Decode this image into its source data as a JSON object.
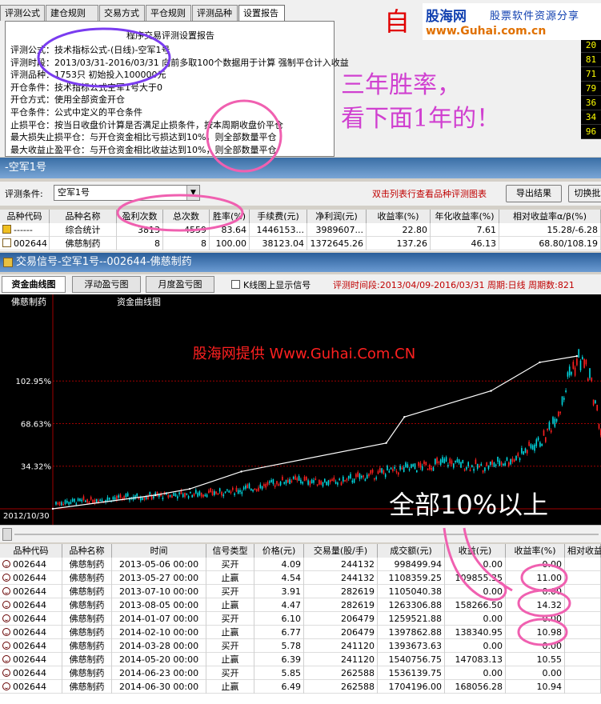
{
  "dialog": {
    "tabs": [
      "评测公式",
      "建仓规则",
      "交易方式",
      "平仓规则",
      "评测品种",
      "设置报告"
    ],
    "active_tab": 5,
    "report_title": "程序交易评测设置报告",
    "report_lines": [
      "评测公式：技术指标公式-(日线)-空军1号",
      "评测时段：2013/03/31-2016/03/31  向前多取100个数据用于计算  强制平仓计入收益",
      "评测品种：1753只  初始投入100000元",
      "开仓条件：技术指标公式空军1号大于0",
      "开仓方式：使用全部资金开仓",
      "平仓条件：公式中定义的平仓条件",
      "止损平仓：按当日收盘价计算是否满足止损条件，按本周期收盘价平仓",
      "          最大损失止损平仓：与开仓资金相比亏损达到10%，则全部数量平仓",
      "          最大收益止盈平仓：与开仓资金相比收益达到10%，则全部数量平仓"
    ],
    "side_numbers": [
      "20",
      "81",
      "71",
      "79",
      "36",
      "34",
      "96"
    ]
  },
  "brand": {
    "name": "股海网",
    "slogan": "股票软件资源分享",
    "url": "www.Guhai.com.cn"
  },
  "annotations": {
    "zi": "自",
    "three_year": "三年胜率，",
    "look_below": "看下面1年的！",
    "all_above": "全部10%以上"
  },
  "panel": {
    "title": "-空军1号",
    "cond_label": "评测条件:",
    "cond_value": "空军1号",
    "hint": "双击列表行查看品种评测图表",
    "export_button": "导出结果",
    "switch_button": "切换批"
  },
  "stat_table": {
    "headers": [
      "品种代码",
      "品种名称",
      "盈利次数",
      "总次数",
      "胜率(%)",
      "手续费(元)",
      "净利润(元)",
      "收益率(%)",
      "年化收益率(%)",
      "相对收益率α/β(%)"
    ],
    "rows": [
      [
        "------",
        "综合统计",
        "3813",
        "4559",
        "83.64",
        "1446153...",
        "3989607...",
        "22.80",
        "7.61",
        "15.28/-6.28"
      ],
      [
        "002644",
        "佛慈制药",
        "8",
        "8",
        "100.00",
        "38123.04",
        "1372645.26",
        "137.26",
        "46.13",
        "68.80/108.19"
      ]
    ]
  },
  "trade_window": {
    "title": "交易信号-空军1号--002644-佛慈制药",
    "tabs": [
      "资金曲线图",
      "浮动盈亏图",
      "月度盈亏图"
    ],
    "checkbox_label": "K线图上显示信号",
    "period_text": "评测时间段:2013/04/09-2016/03/31  周期:日线  周期数:821"
  },
  "chart_data": {
    "type": "line",
    "title": "资金曲线图",
    "stock_label": "佛慈制药",
    "watermark": "股海网提供 Www.Guhai.Com.CN",
    "start_label": "2012/10/30",
    "y_ticks": [
      "102.95%",
      "68.63%",
      "34.32%"
    ],
    "y_tick_values": [
      102.95,
      68.63,
      34.32
    ],
    "ylim": [
      0,
      137.26
    ],
    "series": [
      {
        "name": "资金曲线图",
        "x": [
          0,
          141,
          188,
          259,
          458,
          483,
          602,
          669,
          720
        ],
        "values": [
          0,
          11,
          16,
          30,
          53,
          74,
          95,
          118,
          123
        ]
      }
    ],
    "price_profile": {
      "x": [
        0,
        100,
        160,
        220,
        280,
        320,
        360,
        420,
        480,
        520,
        560,
        600,
        640,
        680,
        700,
        712,
        724,
        732,
        740,
        751
      ],
      "y": [
        0,
        5,
        8,
        10,
        12,
        16,
        22,
        20,
        28,
        32,
        36,
        32,
        38,
        55,
        80,
        108,
        118,
        113,
        95,
        60
      ]
    },
    "colors": {
      "up": "#ff2020",
      "down": "#00d8e0",
      "equity": "#ffffff",
      "grid": "#a00000",
      "axis_text": "#ffffff"
    }
  },
  "trades_table": {
    "headers": [
      "品种代码",
      "品种名称",
      "时间",
      "信号类型",
      "价格(元)",
      "交易量(股/手)",
      "成交额(元)",
      "收益(元)",
      "收益率(%)",
      "相对收益"
    ],
    "rows": [
      [
        "002644",
        "佛慈制药",
        "2013-05-06 00:00",
        "买开",
        "4.09",
        "244132",
        "998499.94",
        "0.00",
        "0.00",
        ""
      ],
      [
        "002644",
        "佛慈制药",
        "2013-05-27 00:00",
        "止赢",
        "4.54",
        "244132",
        "1108359.25",
        "109855.35",
        "11.00",
        ""
      ],
      [
        "002644",
        "佛慈制药",
        "2013-07-10 00:00",
        "买开",
        "3.91",
        "282619",
        "1105040.38",
        "0.00",
        "0.00",
        ""
      ],
      [
        "002644",
        "佛慈制药",
        "2013-08-05 00:00",
        "止赢",
        "4.47",
        "282619",
        "1263306.88",
        "158266.50",
        "14.32",
        ""
      ],
      [
        "002644",
        "佛慈制药",
        "2014-01-07 00:00",
        "买开",
        "6.10",
        "206479",
        "1259521.88",
        "0.00",
        "0.00",
        ""
      ],
      [
        "002644",
        "佛慈制药",
        "2014-02-10 00:00",
        "止赢",
        "6.77",
        "206479",
        "1397862.88",
        "138340.95",
        "10.98",
        ""
      ],
      [
        "002644",
        "佛慈制药",
        "2014-03-28 00:00",
        "买开",
        "5.78",
        "241120",
        "1393673.63",
        "0.00",
        "0.00",
        ""
      ],
      [
        "002644",
        "佛慈制药",
        "2014-05-20 00:00",
        "止赢",
        "6.39",
        "241120",
        "1540756.75",
        "147083.13",
        "10.55",
        ""
      ],
      [
        "002644",
        "佛慈制药",
        "2014-06-23 00:00",
        "买开",
        "5.85",
        "262588",
        "1536139.75",
        "0.00",
        "0.00",
        ""
      ],
      [
        "002644",
        "佛慈制药",
        "2014-06-30 00:00",
        "止赢",
        "6.49",
        "262588",
        "1704196.00",
        "168056.28",
        "10.94",
        ""
      ]
    ]
  }
}
